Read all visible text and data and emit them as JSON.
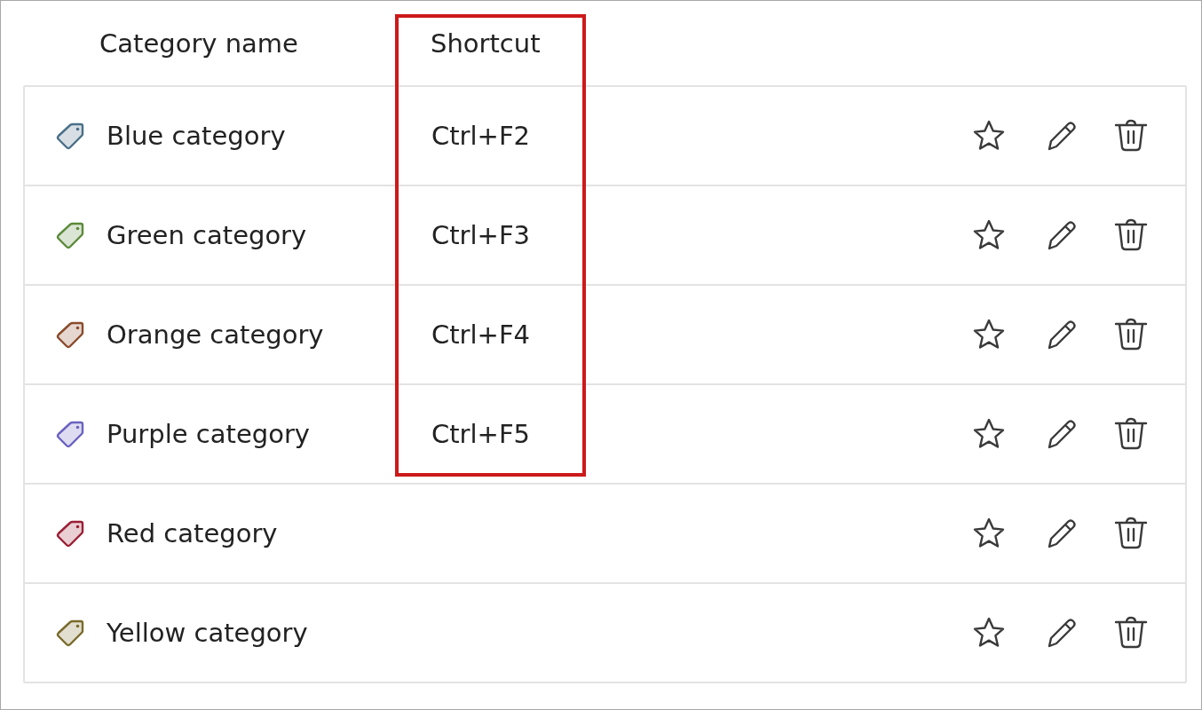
{
  "columns": [
    {
      "label": "Category name",
      "highlighted": false
    },
    {
      "label": "Shortcut",
      "highlighted": true
    }
  ],
  "categories": [
    {
      "name": "Blue category",
      "shortcut": "Ctrl+F2",
      "color": "#4a6f88"
    },
    {
      "name": "Green category",
      "shortcut": "Ctrl+F3",
      "color": "#5b8a3a"
    },
    {
      "name": "Orange category",
      "shortcut": "Ctrl+F4",
      "color": "#8a4a2a"
    },
    {
      "name": "Purple category",
      "shortcut": "Ctrl+F5",
      "color": "#6a62c0"
    },
    {
      "name": "Red category",
      "color": "#9a1f35"
    },
    {
      "name": "Yellow category",
      "color": "#7a6a2a"
    }
  ]
}
